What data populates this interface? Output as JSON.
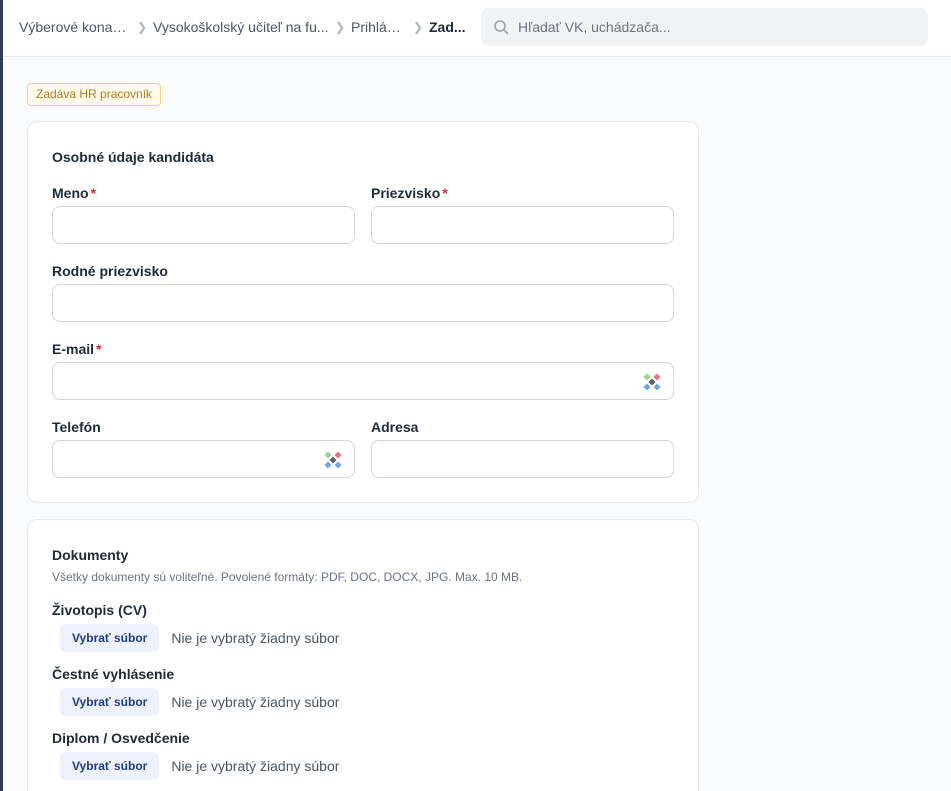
{
  "breadcrumb": [
    {
      "label": "Výberové konania"
    },
    {
      "label": "Vysokoškolský učiteľ na fu..."
    },
    {
      "label": "Prihlášky"
    },
    {
      "label": "Zad..."
    }
  ],
  "search": {
    "placeholder": "Hľadať VK, uchádzača..."
  },
  "badge": {
    "label": "Zadáva HR pracovník"
  },
  "personal": {
    "title": "Osobné údaje kandidáta",
    "fields": {
      "first_name": {
        "label": "Meno",
        "required_mark": "*",
        "value": ""
      },
      "last_name": {
        "label": "Priezvisko",
        "required_mark": "*",
        "value": ""
      },
      "birth_name": {
        "label": "Rodné priezvisko",
        "value": ""
      },
      "email": {
        "label": "E-mail",
        "required_mark": "*",
        "value": ""
      },
      "phone": {
        "label": "Telefón",
        "value": ""
      },
      "address": {
        "label": "Adresa",
        "value": ""
      }
    }
  },
  "documents": {
    "title": "Dokumenty",
    "hint": "Všetky dokumenty sú voliteľné. Povolené formáty: PDF, DOC, DOCX, JPG. Max. 10 MB.",
    "items": [
      {
        "label": "Životopis (CV)",
        "button": "Vybrať súbor",
        "status": "Nie je vybratý žiadny súbor"
      },
      {
        "label": "Čestné vyhlásenie",
        "button": "Vybrať súbor",
        "status": "Nie je vybratý žiadny súbor"
      },
      {
        "label": "Diplom / Osvedčenie",
        "button": "Vybrať súbor",
        "status": "Nie je vybratý žiadny súbor"
      }
    ]
  },
  "icons": {
    "search": "search-icon",
    "autofill": "password-manager-icon",
    "chevron": "chevron-right-icon"
  },
  "colors": {
    "required": "#dc2626",
    "badge_border": "#f3d27a",
    "badge_text": "#b7791f",
    "file_button_bg": "#eef2ff",
    "file_button_text": "#1e3a8a"
  }
}
